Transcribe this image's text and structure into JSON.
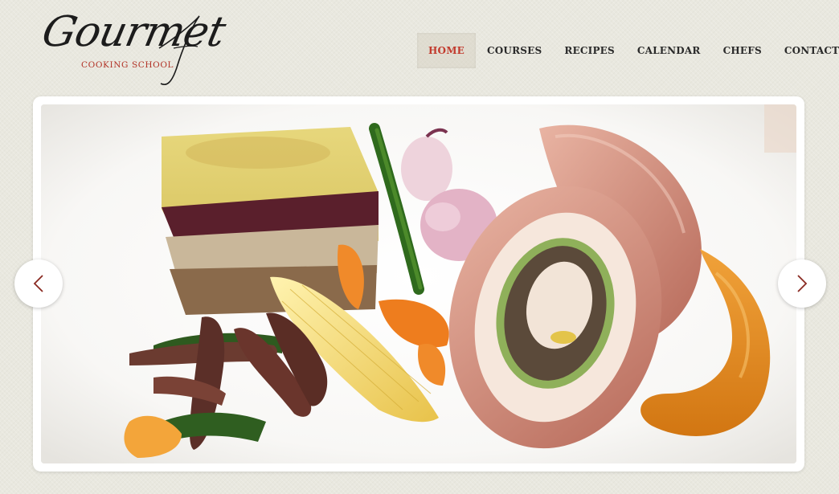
{
  "logo": {
    "title": "Gourmet",
    "subtitle": "COOKING SCHOOL"
  },
  "nav": {
    "items": [
      {
        "label": "HOME",
        "active": true
      },
      {
        "label": "COURSES",
        "active": false
      },
      {
        "label": "RECIPES",
        "active": false
      },
      {
        "label": "CALENDAR",
        "active": false
      },
      {
        "label": "CHEFS",
        "active": false
      },
      {
        "label": "CONTACTS",
        "active": false
      }
    ]
  },
  "slider": {
    "image": "plated-dish-photo",
    "prev_icon": "chevron-left-icon",
    "next_icon": "chevron-right-icon"
  },
  "colors": {
    "accent": "#c23a2d",
    "background": "#e9e8df",
    "nav_text": "#2a2a2a"
  }
}
